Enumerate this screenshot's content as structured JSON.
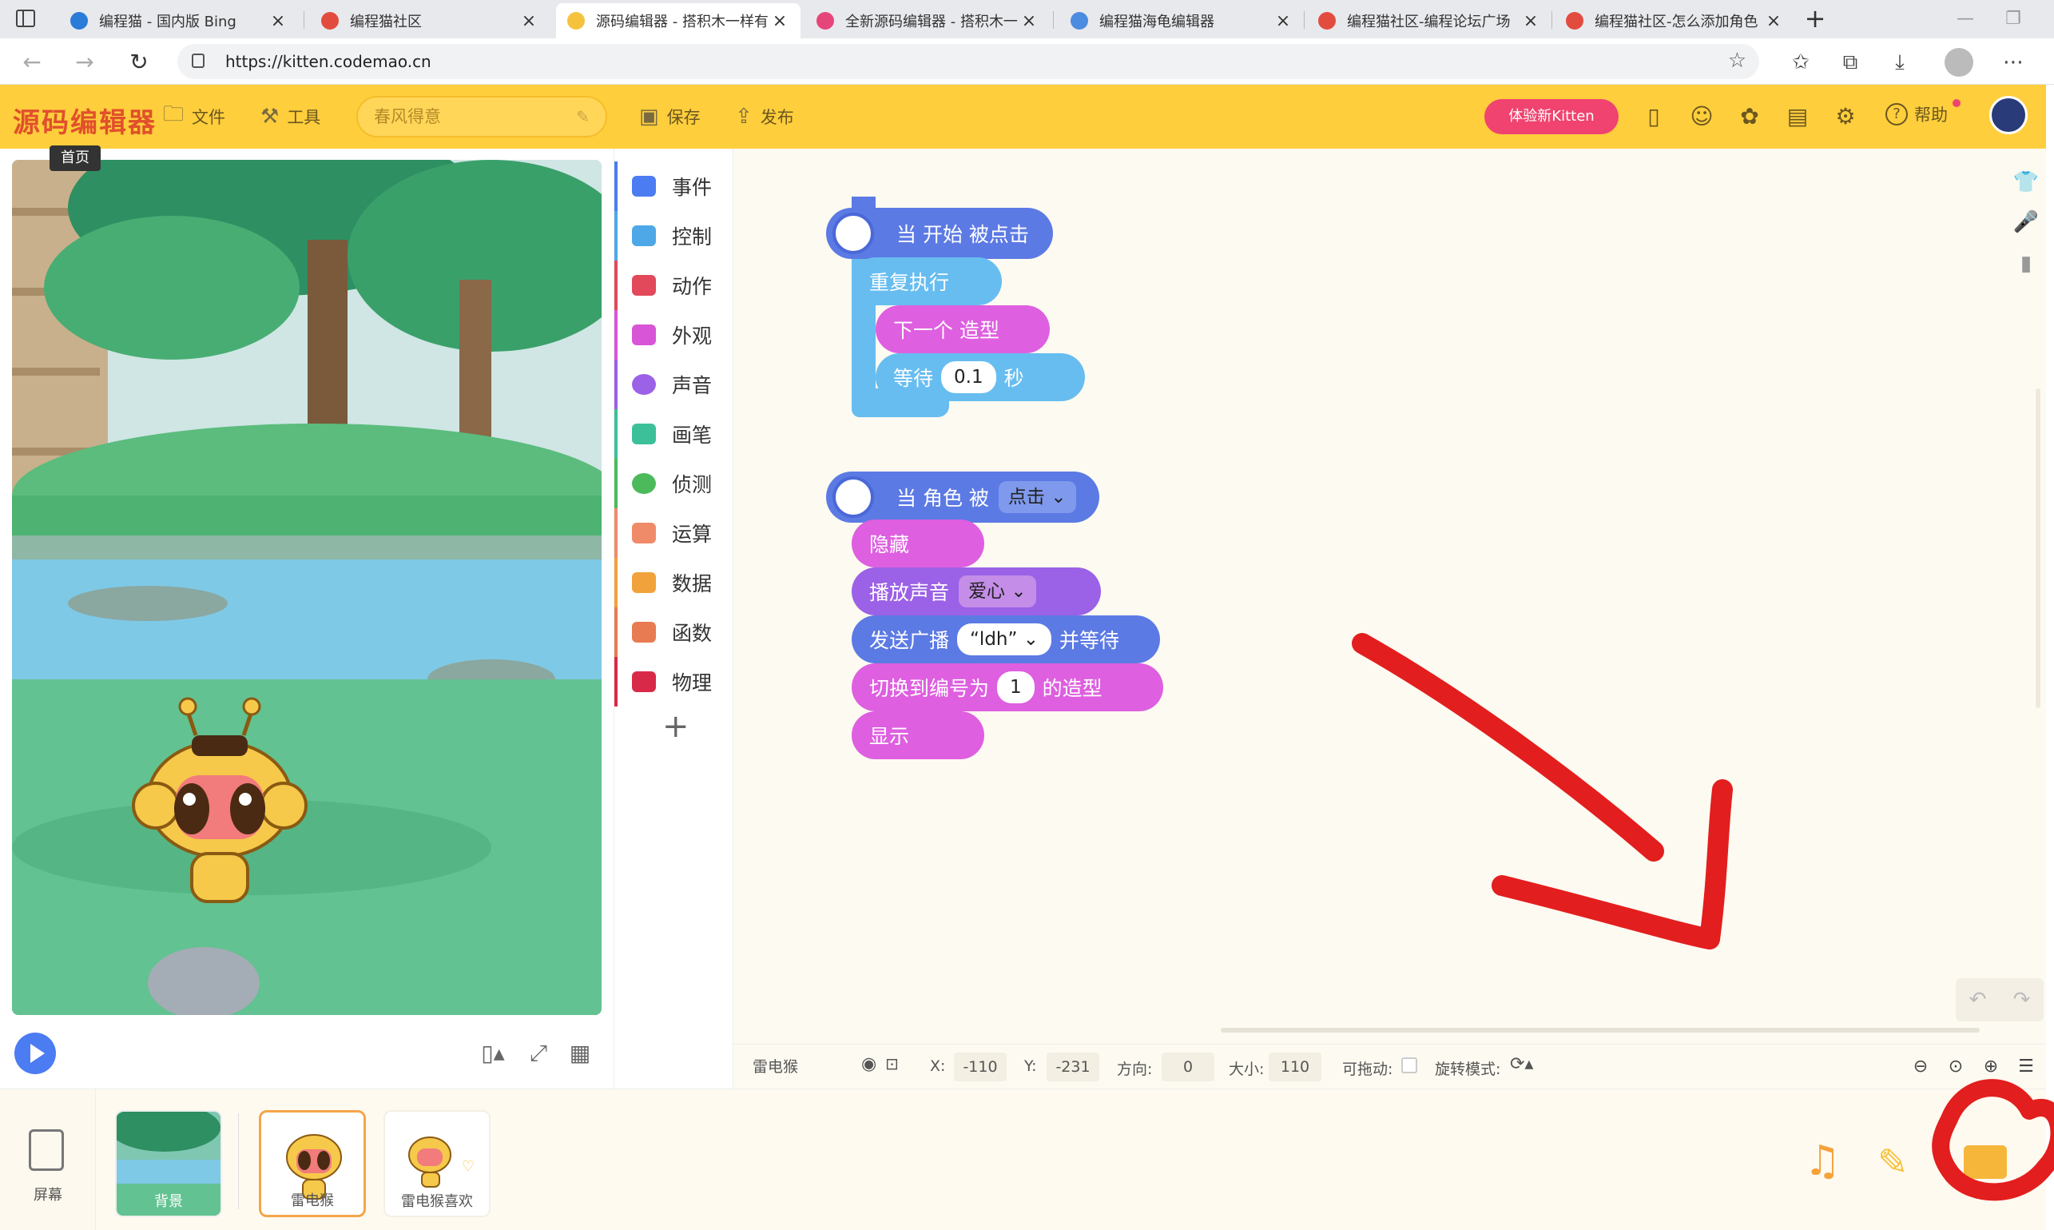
{
  "browser": {
    "tabs": [
      {
        "title": "编程猫 - 国内版 Bing",
        "color": "#2b7bd8",
        "active": false
      },
      {
        "title": "编程猫社区",
        "color": "#e24c3f",
        "active": false
      },
      {
        "title": "源码编辑器 - 搭积木一样有",
        "color": "#f5c23d",
        "active": true
      },
      {
        "title": "全新源码编辑器 - 搭积木一",
        "color": "#e6457a",
        "active": false
      },
      {
        "title": "编程猫海龟编辑器",
        "color": "#4b8be0",
        "active": false
      },
      {
        "title": "编程猫社区-编程论坛广场",
        "color": "#e24c3f",
        "active": false
      },
      {
        "title": "编程猫社区-怎么添加角色",
        "color": "#e24c3f",
        "active": false
      }
    ],
    "url": "https://kitten.codemao.cn"
  },
  "header": {
    "logo": "源码编辑器",
    "file_label": "文件",
    "tools_label": "工具",
    "project_name": "春风得意",
    "save_label": "保存",
    "publish_label": "发布",
    "try_new_label": "体验新Kitten",
    "help_label": "帮助",
    "accent": "#fece3c"
  },
  "stage": {
    "tooltip": "首页"
  },
  "categories": [
    {
      "label": "事件",
      "color": "#4b7cf2"
    },
    {
      "label": "控制",
      "color": "#4ea8e8"
    },
    {
      "label": "动作",
      "color": "#e2495a"
    },
    {
      "label": "外观",
      "color": "#d855d8"
    },
    {
      "label": "声音",
      "color": "#9b61e6"
    },
    {
      "label": "画笔",
      "color": "#3cc09a"
    },
    {
      "label": "侦测",
      "color": "#4cba5a"
    },
    {
      "label": "运算",
      "color": "#f08b6a"
    },
    {
      "label": "数据",
      "color": "#f2a23a"
    },
    {
      "label": "函数",
      "color": "#e87b52"
    },
    {
      "label": "物理",
      "color": "#d82a48"
    }
  ],
  "scripts": {
    "script1": {
      "hat": "当 开始 被点击",
      "repeat": "重复执行",
      "next_costume": "下一个 造型",
      "wait": "等待",
      "wait_value": "0.1",
      "wait_unit": "秒"
    },
    "script2": {
      "hat_prefix": "当 角色 被",
      "hat_option": "点击",
      "hide": "隐藏",
      "play_sound": "播放声音",
      "sound_option": "爱心",
      "broadcast": "发送广播",
      "broadcast_option": "“ldh”",
      "broadcast_suffix": "并等待",
      "switch_costume": "切换到编号为",
      "costume_number": "1",
      "costume_suffix": "的造型",
      "show": "显示"
    }
  },
  "sprite_info": {
    "name": "雷电猴",
    "x_label": "X:",
    "x": "-110",
    "y_label": "Y:",
    "y": "-231",
    "direction_label": "方向:",
    "direction": "0",
    "size_label": "大小:",
    "size": "110",
    "draggable_label": "可拖动:",
    "rotation_label": "旋转模式:"
  },
  "tray": {
    "screen_label": "屏幕",
    "sprites": [
      {
        "label": "背景"
      },
      {
        "label": "雷电猴"
      },
      {
        "label": "雷电猴喜欢"
      }
    ]
  }
}
